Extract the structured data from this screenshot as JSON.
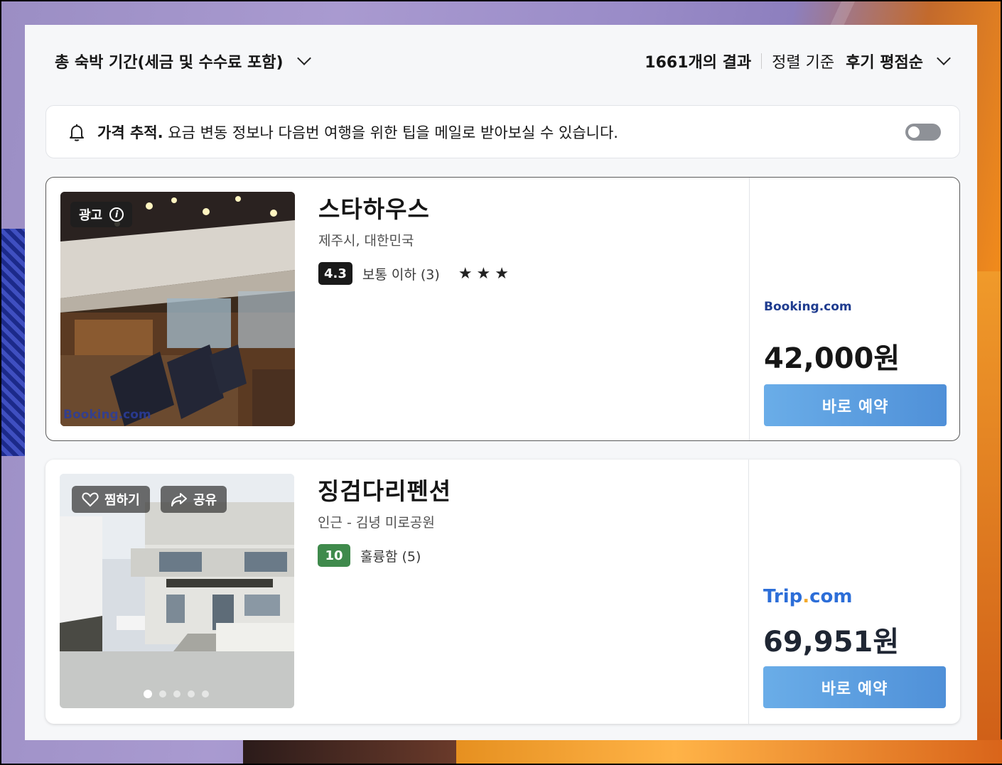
{
  "topbar": {
    "filter_label": "총 숙박 기간(세금 및 수수료 포함)",
    "results": "1661개의 결과",
    "sort_label": "정렬 기준",
    "sort_value": "후기 평점순"
  },
  "price_alert": {
    "title": "가격 추적.",
    "text": " 요금 변동 정보나 다음번 여행을 위한 팁을 메일로 받아보실 수 있습니다.",
    "toggle_on": false
  },
  "hotels": [
    {
      "badge": "광고",
      "name": "스타하우스",
      "location": "제주시, 대한민국",
      "score": "4.3",
      "rating_text": "보통 이하 (3)",
      "stars": "★★★",
      "photo_watermark": "Booking.com",
      "provider": "Booking.com",
      "price": "42,000원",
      "button": "바로 예약"
    },
    {
      "save_label": "찜하기",
      "share_label": "공유",
      "name": "징검다리펜션",
      "location": "인근 - 김녕 미로공원",
      "score": "10",
      "rating_text": "훌륭함 (5)",
      "provider_main": "Trip",
      "provider_dot": ".",
      "provider_tail": "com",
      "price": "69,951원",
      "button": "바로 예약",
      "photo_count": 5,
      "photo_active": 1
    }
  ],
  "colors": {
    "button": "#5a9fe0",
    "score_dark": "#1a1a1a",
    "score_green": "#3f8a4c",
    "booking_blue": "#1f3c8f",
    "trip_blue": "#2c6ed8"
  }
}
